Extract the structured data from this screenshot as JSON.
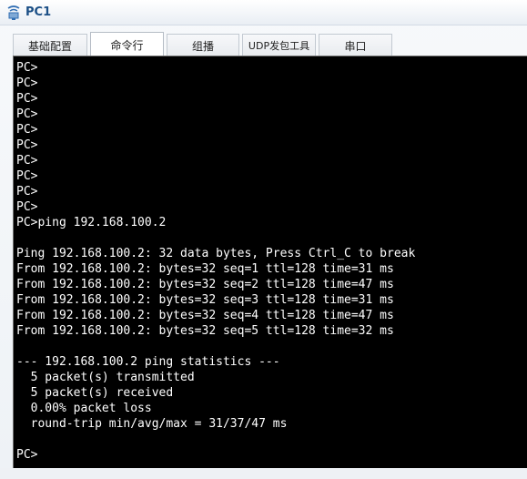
{
  "window": {
    "title": "PC1",
    "icon": "network-pc-icon"
  },
  "tabs": [
    {
      "label": "基础配置",
      "active": false
    },
    {
      "label": "命令行",
      "active": true
    },
    {
      "label": "组播",
      "active": false
    },
    {
      "label": "UDP发包工具",
      "active": false
    },
    {
      "label": "串口",
      "active": false
    }
  ],
  "terminal": {
    "lines": [
      "PC>",
      "PC>",
      "PC>",
      "PC>",
      "PC>",
      "PC>",
      "PC>",
      "PC>",
      "PC>",
      "PC>",
      "PC>ping 192.168.100.2",
      "",
      "Ping 192.168.100.2: 32 data bytes, Press Ctrl_C to break",
      "From 192.168.100.2: bytes=32 seq=1 ttl=128 time=31 ms",
      "From 192.168.100.2: bytes=32 seq=2 ttl=128 time=47 ms",
      "From 192.168.100.2: bytes=32 seq=3 ttl=128 time=31 ms",
      "From 192.168.100.2: bytes=32 seq=4 ttl=128 time=47 ms",
      "From 192.168.100.2: bytes=32 seq=5 ttl=128 time=32 ms",
      "",
      "--- 192.168.100.2 ping statistics ---",
      "  5 packet(s) transmitted",
      "  5 packet(s) received",
      "  0.00% packet loss",
      "  round-trip min/avg/max = 31/37/47 ms",
      "",
      "PC>"
    ]
  },
  "colors": {
    "terminal_bg": "#000000",
    "terminal_fg": "#ffffff",
    "title_color": "#1b4f86"
  }
}
